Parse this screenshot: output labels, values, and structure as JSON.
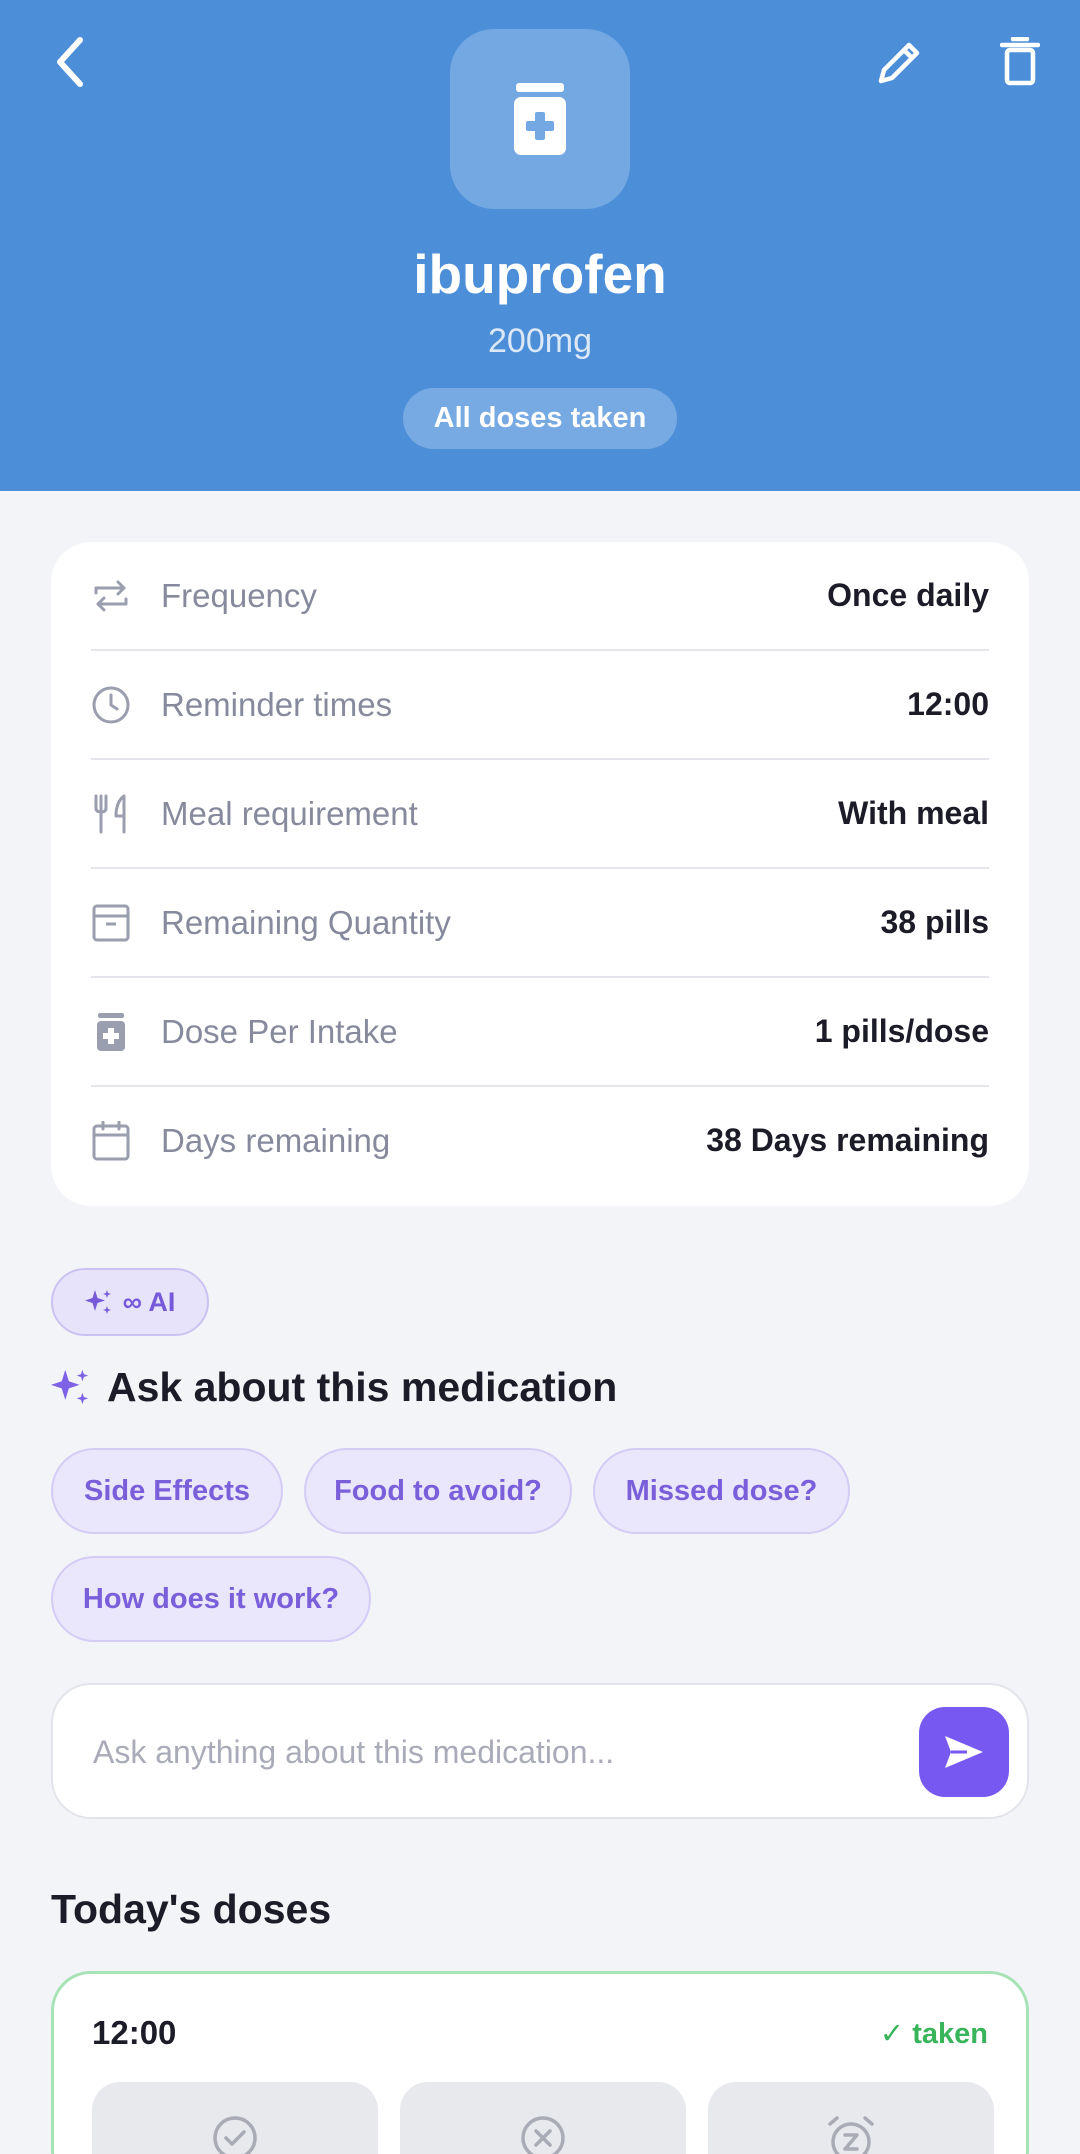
{
  "header": {
    "medication_name": "ibuprofen",
    "strength": "200mg",
    "status_pill": "All doses taken",
    "colors": {
      "background": "#4c8fd8",
      "icon_box": "#74a8e2"
    }
  },
  "details": [
    {
      "icon": "repeat-icon",
      "label": "Frequency",
      "value": "Once daily"
    },
    {
      "icon": "clock-icon",
      "label": "Reminder times",
      "value": "12:00"
    },
    {
      "icon": "utensils-icon",
      "label": "Meal requirement",
      "value": "With meal"
    },
    {
      "icon": "archive-icon",
      "label": "Remaining Quantity",
      "value": "38 pills"
    },
    {
      "icon": "pill-bottle-icon",
      "label": "Dose Per Intake",
      "value": "1 pills/dose"
    },
    {
      "icon": "calendar-icon",
      "label": "Days remaining",
      "value": "38 Days remaining"
    }
  ],
  "ai": {
    "badge_label": "∞ AI",
    "section_title": "Ask about this medication",
    "suggestions": [
      "Side Effects",
      "Food to avoid?",
      "Missed dose?",
      "How does it work?"
    ],
    "input_placeholder": "Ask anything about this medication...",
    "accent": "#7759f2"
  },
  "today": {
    "section_title": "Today's doses",
    "doses": [
      {
        "time": "12:00",
        "status": "✓ taken",
        "actions": [
          "check-circle-icon",
          "x-circle-icon",
          "snooze-alarm-icon"
        ]
      }
    ],
    "status_color": "#38b45a"
  }
}
